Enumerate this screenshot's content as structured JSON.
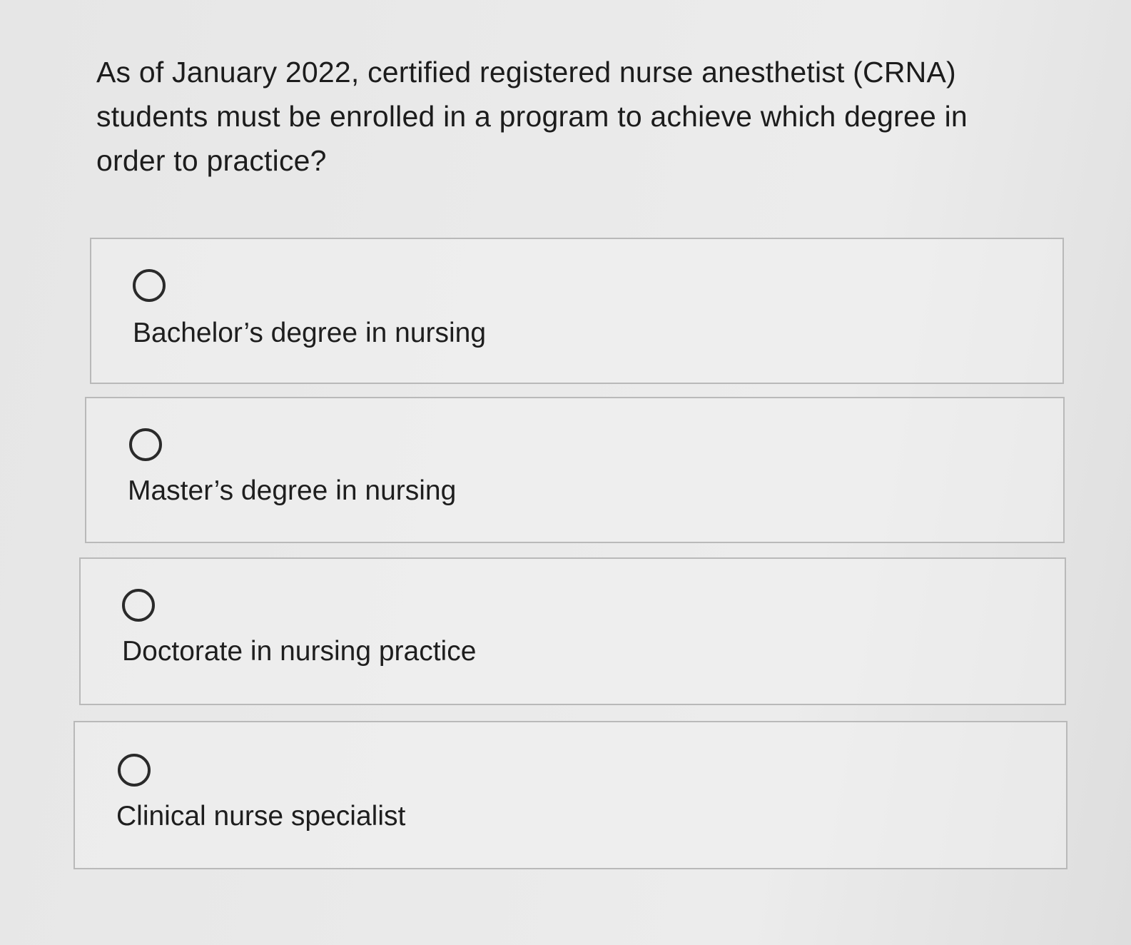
{
  "question": {
    "text": "As of January 2022, certified registered nurse anesthetist (CRNA) students must be enrolled in a program to achieve which degree in order to practice?"
  },
  "options": [
    {
      "label": "Bachelor’s degree in nursing",
      "selected": false
    },
    {
      "label": "Master’s degree in nursing",
      "selected": false
    },
    {
      "label": "Doctorate in nursing practice",
      "selected": false
    },
    {
      "label": "Clinical nurse specialist",
      "selected": false
    }
  ],
  "colors": {
    "background": "#e8e8e8",
    "text": "#1e1e1e",
    "border": "#b9b9b9",
    "radio": "#2a2a2a"
  }
}
